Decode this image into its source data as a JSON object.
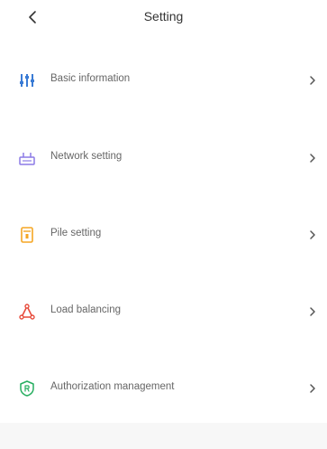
{
  "header": {
    "title": "Setting",
    "back_icon": "chevron-left-icon"
  },
  "menu": {
    "items": [
      {
        "label": "Basic information",
        "icon": "sliders-icon",
        "color": "#3a7bd5"
      },
      {
        "label": "Network setting",
        "icon": "router-icon",
        "color": "#8c7ae6"
      },
      {
        "label": "Pile setting",
        "icon": "charging-pile-icon",
        "color": "#f5a623"
      },
      {
        "label": "Load balancing",
        "icon": "network-triangle-icon",
        "color": "#e74c3c"
      },
      {
        "label": "Authorization management",
        "icon": "shield-icon",
        "color": "#27ae60"
      }
    ]
  },
  "colors": {
    "text": "#333333",
    "label": "#666666",
    "chevron": "#555555",
    "bottom_band": "#f7f7f7"
  }
}
